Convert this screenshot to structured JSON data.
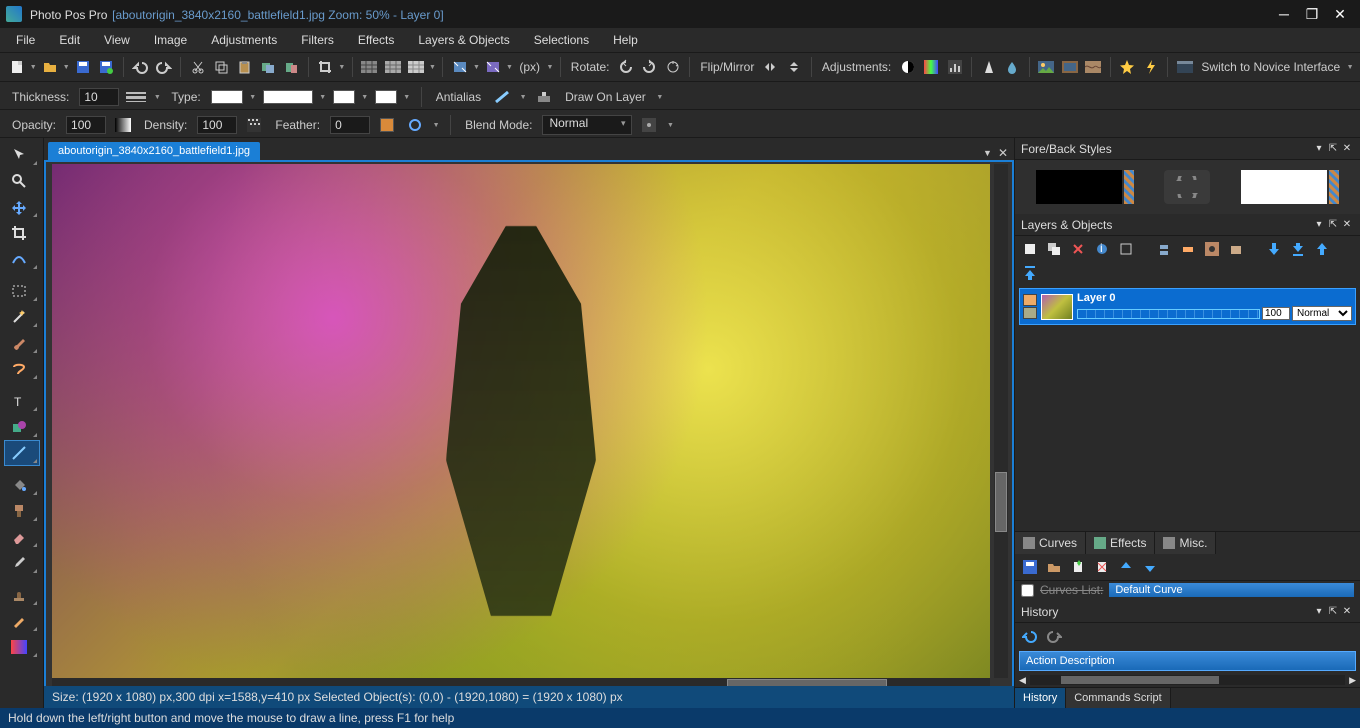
{
  "app": {
    "name": "Photo Pos Pro",
    "doc_title": "[aboutorigin_3840x2160_battlefield1.jpg Zoom: 50% - Layer 0]"
  },
  "menu": [
    "File",
    "Edit",
    "View",
    "Image",
    "Adjustments",
    "Filters",
    "Effects",
    "Layers & Objects",
    "Selections",
    "Help"
  ],
  "toolbar1": {
    "rotate_label": "Rotate:",
    "flip_label": "Flip/Mirror",
    "adjust_label": "Adjustments:",
    "px_label": "(px)",
    "switch_label": "Switch to Novice Interface"
  },
  "options": {
    "thickness_label": "Thickness:",
    "thickness_value": "10",
    "type_label": "Type:",
    "antialias_label": "Antialias",
    "draw_on_layer_label": "Draw On Layer",
    "opacity_label": "Opacity:",
    "opacity_value": "100",
    "density_label": "Density:",
    "density_value": "100",
    "feather_label": "Feather:",
    "feather_value": "0",
    "blend_label": "Blend Mode:",
    "blend_value": "Normal"
  },
  "doc_tab": "aboutorigin_3840x2160_battlefield1.jpg",
  "status_canvas": "Size: (1920 x 1080) px,300 dpi   x=1588,y=410 px   Selected Object(s): (0,0) - (1920,1080) =  (1920 x 1080) px",
  "right": {
    "forestyles_title": "Fore/Back Styles",
    "layers_title": "Layers & Objects",
    "layer_name": "Layer 0",
    "layer_opacity": "100",
    "layer_blend": "Normal",
    "curves_tab": "Curves",
    "effects_tab": "Effects",
    "misc_tab": "Misc.",
    "curves_list_label": "Curves List:",
    "curves_preset": "Default Curve",
    "history_title": "History",
    "history_item": "Action Description",
    "history_tab": "History",
    "commands_tab": "Commands Script"
  },
  "bottom_hint": "Hold down the left/right button and move the mouse to draw a line, press F1 for help",
  "colors": {
    "fore": "#000000",
    "back": "#ffffff",
    "feather_swatch": "#d98a3a"
  }
}
